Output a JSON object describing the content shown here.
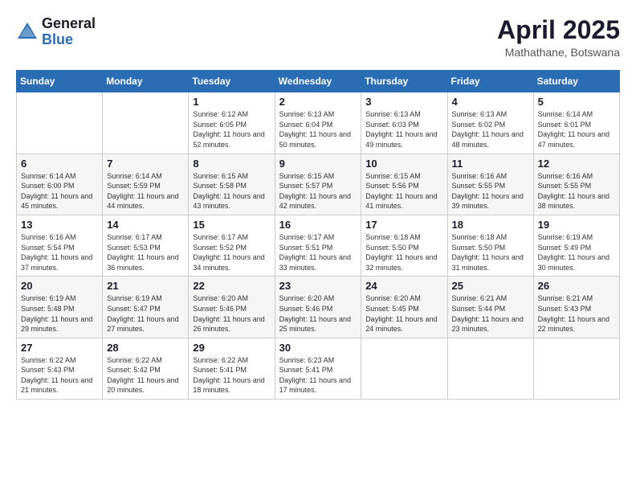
{
  "logo": {
    "general": "General",
    "blue": "Blue"
  },
  "title": "April 2025",
  "location": "Mathathane, Botswana",
  "headers": [
    "Sunday",
    "Monday",
    "Tuesday",
    "Wednesday",
    "Thursday",
    "Friday",
    "Saturday"
  ],
  "weeks": [
    [
      {
        "day": "",
        "info": ""
      },
      {
        "day": "",
        "info": ""
      },
      {
        "day": "1",
        "info": "Sunrise: 6:12 AM\nSunset: 6:05 PM\nDaylight: 11 hours and 52 minutes."
      },
      {
        "day": "2",
        "info": "Sunrise: 6:13 AM\nSunset: 6:04 PM\nDaylight: 11 hours and 50 minutes."
      },
      {
        "day": "3",
        "info": "Sunrise: 6:13 AM\nSunset: 6:03 PM\nDaylight: 11 hours and 49 minutes."
      },
      {
        "day": "4",
        "info": "Sunrise: 6:13 AM\nSunset: 6:02 PM\nDaylight: 11 hours and 48 minutes."
      },
      {
        "day": "5",
        "info": "Sunrise: 6:14 AM\nSunset: 6:01 PM\nDaylight: 11 hours and 47 minutes."
      }
    ],
    [
      {
        "day": "6",
        "info": "Sunrise: 6:14 AM\nSunset: 6:00 PM\nDaylight: 11 hours and 45 minutes."
      },
      {
        "day": "7",
        "info": "Sunrise: 6:14 AM\nSunset: 5:59 PM\nDaylight: 11 hours and 44 minutes."
      },
      {
        "day": "8",
        "info": "Sunrise: 6:15 AM\nSunset: 5:58 PM\nDaylight: 11 hours and 43 minutes."
      },
      {
        "day": "9",
        "info": "Sunrise: 6:15 AM\nSunset: 5:57 PM\nDaylight: 11 hours and 42 minutes."
      },
      {
        "day": "10",
        "info": "Sunrise: 6:15 AM\nSunset: 5:56 PM\nDaylight: 11 hours and 41 minutes."
      },
      {
        "day": "11",
        "info": "Sunrise: 6:16 AM\nSunset: 5:55 PM\nDaylight: 11 hours and 39 minutes."
      },
      {
        "day": "12",
        "info": "Sunrise: 6:16 AM\nSunset: 5:55 PM\nDaylight: 11 hours and 38 minutes."
      }
    ],
    [
      {
        "day": "13",
        "info": "Sunrise: 6:16 AM\nSunset: 5:54 PM\nDaylight: 11 hours and 37 minutes."
      },
      {
        "day": "14",
        "info": "Sunrise: 6:17 AM\nSunset: 5:53 PM\nDaylight: 11 hours and 36 minutes."
      },
      {
        "day": "15",
        "info": "Sunrise: 6:17 AM\nSunset: 5:52 PM\nDaylight: 11 hours and 34 minutes."
      },
      {
        "day": "16",
        "info": "Sunrise: 6:17 AM\nSunset: 5:51 PM\nDaylight: 11 hours and 33 minutes."
      },
      {
        "day": "17",
        "info": "Sunrise: 6:18 AM\nSunset: 5:50 PM\nDaylight: 11 hours and 32 minutes."
      },
      {
        "day": "18",
        "info": "Sunrise: 6:18 AM\nSunset: 5:50 PM\nDaylight: 11 hours and 31 minutes."
      },
      {
        "day": "19",
        "info": "Sunrise: 6:19 AM\nSunset: 5:49 PM\nDaylight: 11 hours and 30 minutes."
      }
    ],
    [
      {
        "day": "20",
        "info": "Sunrise: 6:19 AM\nSunset: 5:48 PM\nDaylight: 11 hours and 29 minutes."
      },
      {
        "day": "21",
        "info": "Sunrise: 6:19 AM\nSunset: 5:47 PM\nDaylight: 11 hours and 27 minutes."
      },
      {
        "day": "22",
        "info": "Sunrise: 6:20 AM\nSunset: 5:46 PM\nDaylight: 11 hours and 26 minutes."
      },
      {
        "day": "23",
        "info": "Sunrise: 6:20 AM\nSunset: 5:46 PM\nDaylight: 11 hours and 25 minutes."
      },
      {
        "day": "24",
        "info": "Sunrise: 6:20 AM\nSunset: 5:45 PM\nDaylight: 11 hours and 24 minutes."
      },
      {
        "day": "25",
        "info": "Sunrise: 6:21 AM\nSunset: 5:44 PM\nDaylight: 11 hours and 23 minutes."
      },
      {
        "day": "26",
        "info": "Sunrise: 6:21 AM\nSunset: 5:43 PM\nDaylight: 11 hours and 22 minutes."
      }
    ],
    [
      {
        "day": "27",
        "info": "Sunrise: 6:22 AM\nSunset: 5:43 PM\nDaylight: 11 hours and 21 minutes."
      },
      {
        "day": "28",
        "info": "Sunrise: 6:22 AM\nSunset: 5:42 PM\nDaylight: 11 hours and 20 minutes."
      },
      {
        "day": "29",
        "info": "Sunrise: 6:22 AM\nSunset: 5:41 PM\nDaylight: 11 hours and 18 minutes."
      },
      {
        "day": "30",
        "info": "Sunrise: 6:23 AM\nSunset: 5:41 PM\nDaylight: 11 hours and 17 minutes."
      },
      {
        "day": "",
        "info": ""
      },
      {
        "day": "",
        "info": ""
      },
      {
        "day": "",
        "info": ""
      }
    ]
  ]
}
